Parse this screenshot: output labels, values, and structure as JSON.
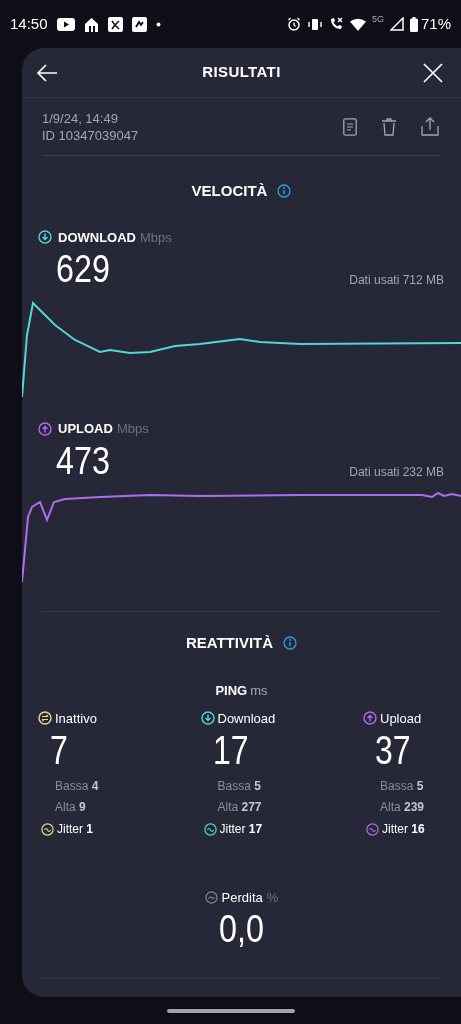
{
  "status_bar": {
    "time": "14:50",
    "network": "5G",
    "battery": "71%"
  },
  "header": {
    "title": "RISULTATI"
  },
  "result": {
    "date": "1/9/24, 14:49",
    "id": "ID 10347039047"
  },
  "speed": {
    "title": "VELOCITÀ",
    "metrics": [
      {
        "kind": "download",
        "label": "DOWNLOAD",
        "unit": "Mbps",
        "value": "629",
        "data_used": "Dati usati 712 MB"
      },
      {
        "kind": "upload",
        "label": "UPLOAD",
        "unit": "Mbps",
        "value": "473",
        "data_used": "Dati usati 232 MB"
      }
    ]
  },
  "responsiveness": {
    "title": "REATTIVITÀ",
    "ping": {
      "label": "PING",
      "unit": "ms"
    },
    "columns": [
      {
        "kind": "idle",
        "label": "Inattivo",
        "value": "7",
        "low_label": "Bassa",
        "low": "4",
        "high_label": "Alta",
        "high": "9",
        "jitter_label": "Jitter",
        "jitter": "1"
      },
      {
        "kind": "download",
        "label": "Download",
        "value": "17",
        "low_label": "Bassa",
        "low": "5",
        "high_label": "Alta",
        "high": "277",
        "jitter_label": "Jitter",
        "jitter": "17"
      },
      {
        "kind": "upload",
        "label": "Upload",
        "value": "37",
        "low_label": "Bassa",
        "low": "5",
        "high_label": "Alta",
        "high": "239",
        "jitter_label": "Jitter",
        "jitter": "16"
      }
    ],
    "loss": {
      "label": "Perdita",
      "unit": "%",
      "value": "0,0"
    }
  }
}
